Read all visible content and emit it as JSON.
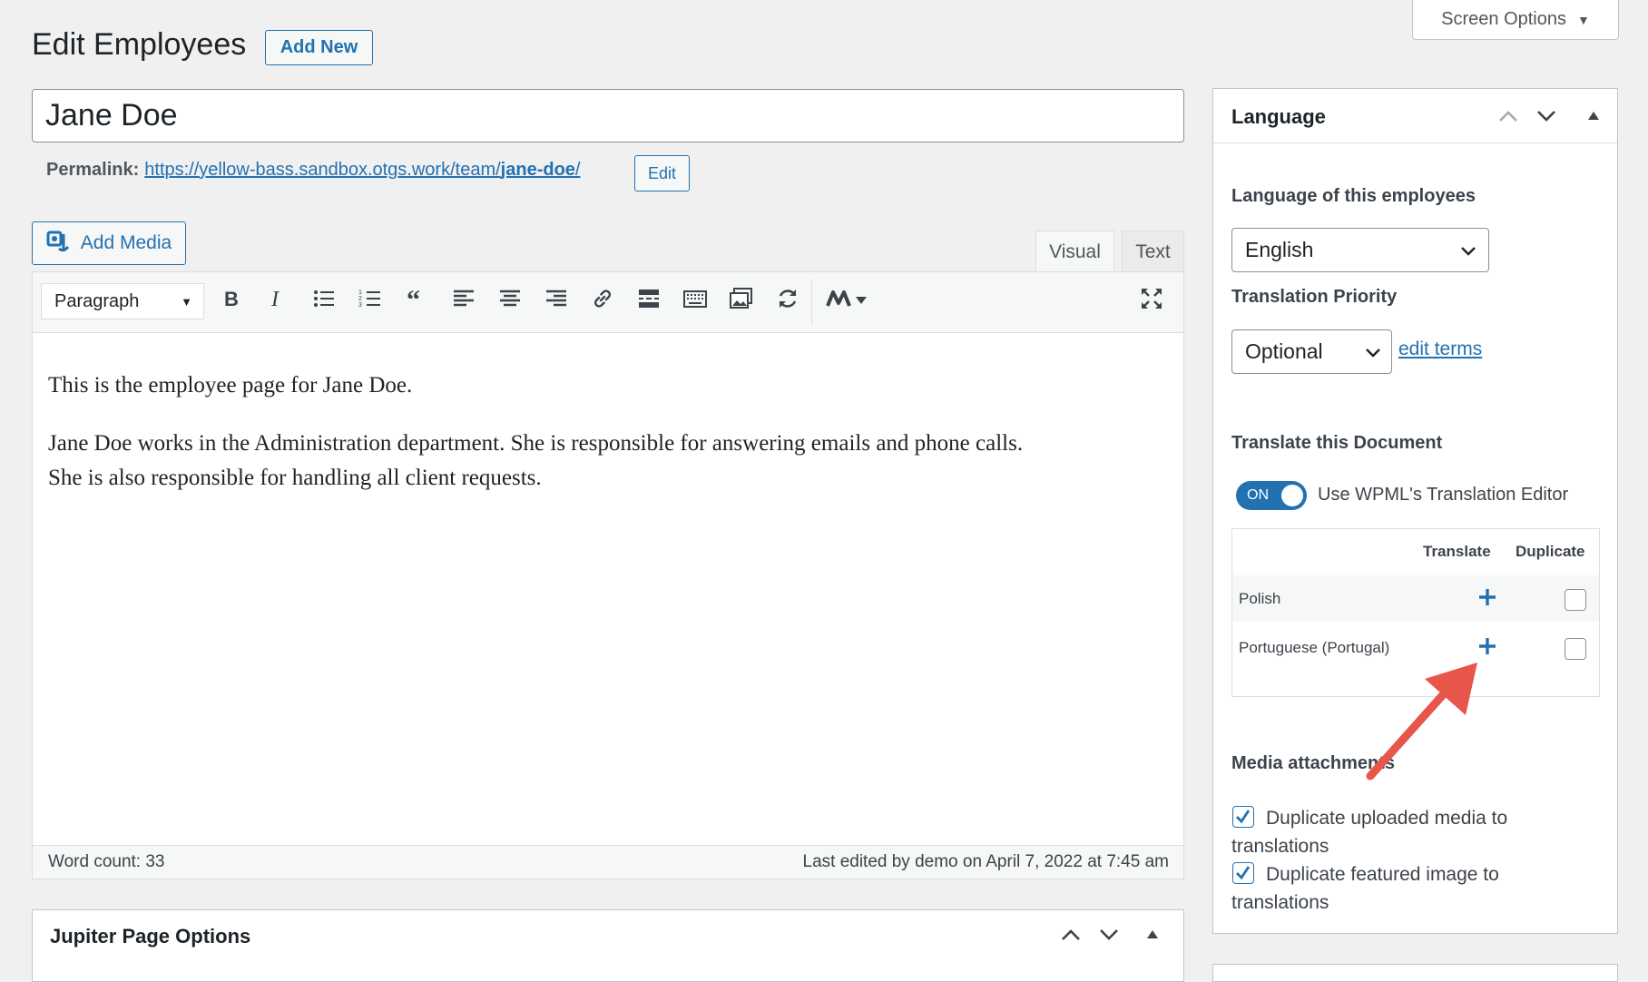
{
  "screen_options": {
    "label": "Screen Options"
  },
  "header": {
    "title": "Edit Employees",
    "add_new": "Add New"
  },
  "post": {
    "title": "Jane Doe",
    "permalink_label": "Permalink:",
    "permalink_base": "https://yellow-bass.sandbox.otgs.work/team/",
    "permalink_slug": "jane-doe",
    "permalink_end": "/",
    "edit_label": "Edit"
  },
  "editor": {
    "add_media": "Add Media",
    "tabs": {
      "visual": "Visual",
      "text": "Text"
    },
    "format_select": "Paragraph",
    "content": {
      "p1": "This is the employee page for Jane Doe.",
      "p2_line1": "Jane Doe works in the Administration department. She is responsible for answering emails and phone calls.",
      "p2_line2": "She is also responsible for handling all client requests."
    },
    "word_count": "Word count: 33",
    "last_edited": "Last edited by demo on April 7, 2022 at 7:45 am"
  },
  "jupiter": {
    "title": "Jupiter Page Options"
  },
  "language_panel": {
    "title": "Language",
    "lang_label": "Language of this employees",
    "lang_value": "English",
    "priority_label": "Translation Priority",
    "priority_value": "Optional",
    "edit_terms": "edit terms",
    "translate_doc_label": "Translate this Document",
    "toggle_state": "ON",
    "toggle_label": "Use WPML's Translation Editor",
    "table": {
      "col_translate": "Translate",
      "col_duplicate": "Duplicate",
      "rows": [
        {
          "language": "Polish"
        },
        {
          "language": "Portuguese (Portugal)"
        }
      ]
    },
    "media_label": "Media attachments",
    "media_opt1_line1": "Duplicate uploaded media to",
    "media_opt1_line2": "translations",
    "media_opt2_line1": "Duplicate featured image to",
    "media_opt2_line2": "translations"
  },
  "colors": {
    "accent": "#2271b1",
    "arrow": "#e8554a",
    "toggle": "#2271b1"
  }
}
